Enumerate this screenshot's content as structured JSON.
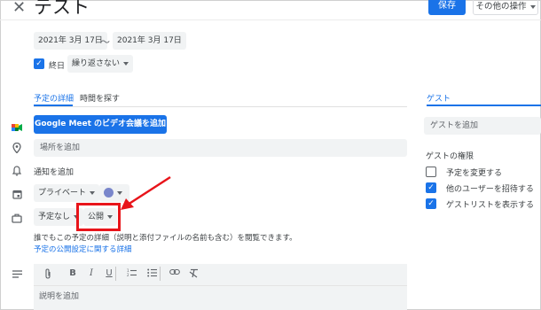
{
  "header": {
    "close_icon": "close-icon",
    "title": "テスト",
    "save_label": "保存",
    "more_actions_label": "その他の操作"
  },
  "dates": {
    "start": "2021年 3月 17日",
    "separator": "～",
    "end": "2021年 3月 17日"
  },
  "allday": {
    "checked": true,
    "label": "終日",
    "repeat_label": "繰り返さない"
  },
  "tabs": [
    {
      "label": "予定の詳細",
      "active": true
    },
    {
      "label": "時間を探す",
      "active": false
    }
  ],
  "details": {
    "meet_button_label": "Google Meet のビデオ会議を追加",
    "location_placeholder": "場所を追加",
    "notification_label": "通知を追加",
    "calendar_label": "プライベート",
    "calendar_color": "#7986cb",
    "availability_label": "予定なし",
    "visibility_label": "公開",
    "visibility_info": "誰でもこの予定の詳細（説明と添付ファイルの名前も含む）を閲覧できます。",
    "visibility_link": "予定の公開設定に関する詳細",
    "description_placeholder": "説明を追加"
  },
  "guests": {
    "tab_label": "ゲスト",
    "add_placeholder": "ゲストを追加",
    "permissions_title": "ゲストの権限",
    "permissions": [
      {
        "label": "予定を変更する",
        "checked": false
      },
      {
        "label": "他のユーザーを招待する",
        "checked": true
      },
      {
        "label": "ゲストリストを表示する",
        "checked": true
      }
    ]
  },
  "colors": {
    "accent": "#1a73e8",
    "highlight_box": "#e8141a",
    "arrow": "#e8141a"
  }
}
